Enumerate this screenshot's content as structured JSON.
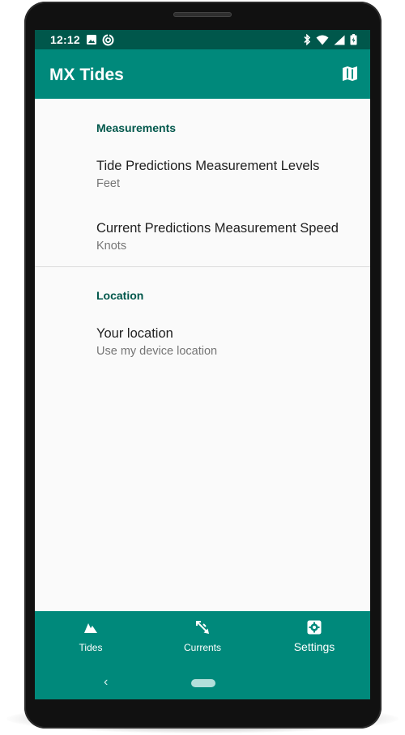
{
  "status_bar": {
    "time": "12:12"
  },
  "app_bar": {
    "title": "MX Tides"
  },
  "settings": {
    "measurements": {
      "header": "Measurements",
      "tide_levels": {
        "title": "Tide Predictions Measurement Levels",
        "summary": "Feet"
      },
      "current_speed": {
        "title": "Current Predictions Measurement Speed",
        "summary": "Knots"
      }
    },
    "location": {
      "header": "Location",
      "your_location": {
        "title": "Your location",
        "summary": "Use my device location"
      }
    }
  },
  "bottom_nav": {
    "items": [
      {
        "label": "Tides",
        "icon": "tide-icon"
      },
      {
        "label": "Currents",
        "icon": "currents-icon"
      },
      {
        "label": "Settings",
        "icon": "settings-icon",
        "active": true
      }
    ]
  },
  "system_nav": {
    "back": "‹"
  },
  "colors": {
    "primary": "#00897b",
    "primary_dark": "#00574b",
    "accent_text": "#00574b",
    "background": "#fafafa"
  }
}
